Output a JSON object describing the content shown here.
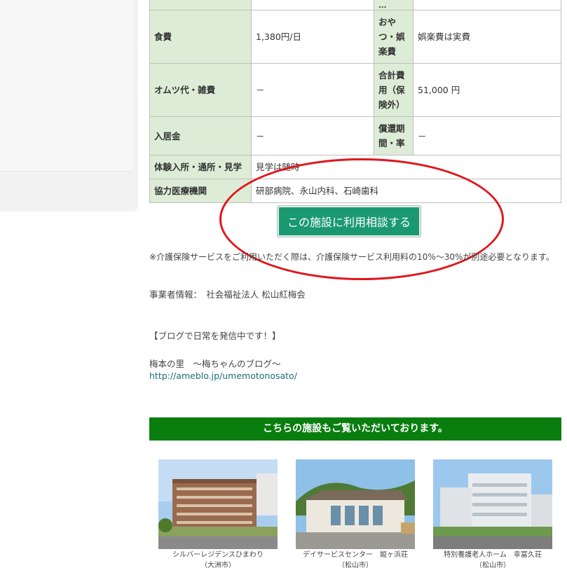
{
  "table": {
    "rows": [
      {
        "l1": "",
        "v1": "",
        "l2": "...",
        "v2": ""
      },
      {
        "l1": "食費",
        "v1": "1,380円/日",
        "l2": "おやつ・娯楽費",
        "v2": "娯楽費は実費"
      },
      {
        "l1": "オムツ代・雑費",
        "v1": "－",
        "l2": "合計費用（保険外）",
        "v2": "51,000 円"
      },
      {
        "l1": "入居金",
        "v1": "－",
        "l2": "償還期間・率",
        "v2": "－"
      }
    ],
    "wide_rows": [
      {
        "label": "体験入所・通所・見学",
        "value": "見学は随時"
      },
      {
        "label": "協力医療機関",
        "value": "研部病院、永山内科、石崎歯科"
      }
    ]
  },
  "cta": {
    "label": "この施設に利用相談する"
  },
  "note": "※介護保険サービスをご利用いただく際は、介護保険サービス利用料の10%〜30%が別途必要となります。",
  "operator": "事業者情報：　社会福祉法人 松山紅梅会",
  "blog": {
    "heading": "【ブログで日常を発信中です！】",
    "name": "梅本の里　～梅ちゃんのブログ～",
    "url": "http://ameblo.jp/umemotonosato/"
  },
  "related": {
    "heading": "こちらの施設もご覧いただいております。",
    "items": [
      {
        "name": "シルバーレジデンスひまわり",
        "area": "（大洲市）"
      },
      {
        "name": "デイサービスセンター　姫ヶ浜荘",
        "area": "（松山市）"
      },
      {
        "name": "特別養護老人ホーム　幸富久荘",
        "area": "（松山市）"
      }
    ]
  },
  "colors": {
    "accent": "#1a9970",
    "header_cell": "#ddecd6",
    "banner": "#0a7d0f",
    "highlight": "#e0161c"
  }
}
